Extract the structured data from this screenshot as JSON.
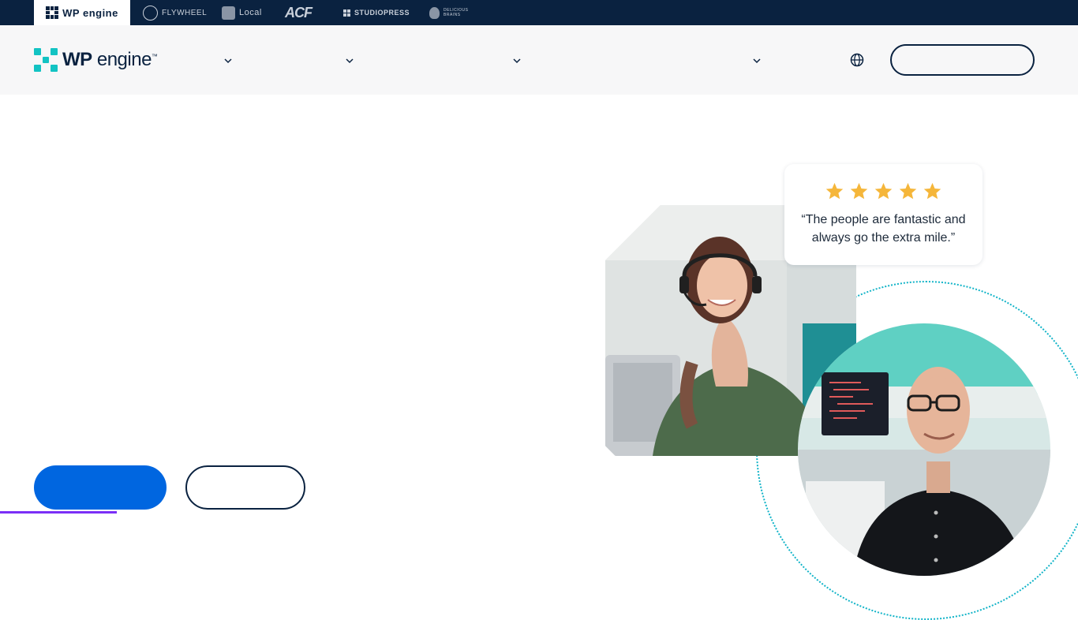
{
  "brand_bar": {
    "wpengine_label": "WP engine",
    "flywheel_label": "FLYWHEEL",
    "local_label": "Local",
    "acf_label": "ACF",
    "studiopress_label": "STUDIOPRESS",
    "delicious_label": "DELICIOUS BRAINS"
  },
  "header": {
    "logo_text_bold": "WP",
    "logo_text_rest": " engine",
    "logo_trademark": "™",
    "nav_icons": [
      "chevron-down-icon",
      "chevron-down-icon",
      "chevron-down-icon",
      "chevron-down-icon"
    ],
    "globe_icon": "globe-icon"
  },
  "review": {
    "rating": 5,
    "rating_max": 5,
    "quote": "“The people are fantastic and always go the extra mile.”",
    "star_color": "#f5b63a"
  },
  "colors": {
    "navy": "#0a2240",
    "brand_teal": "#12c3c3",
    "primary_blue": "#0066e0",
    "accent_purple": "#7b2ff7"
  }
}
